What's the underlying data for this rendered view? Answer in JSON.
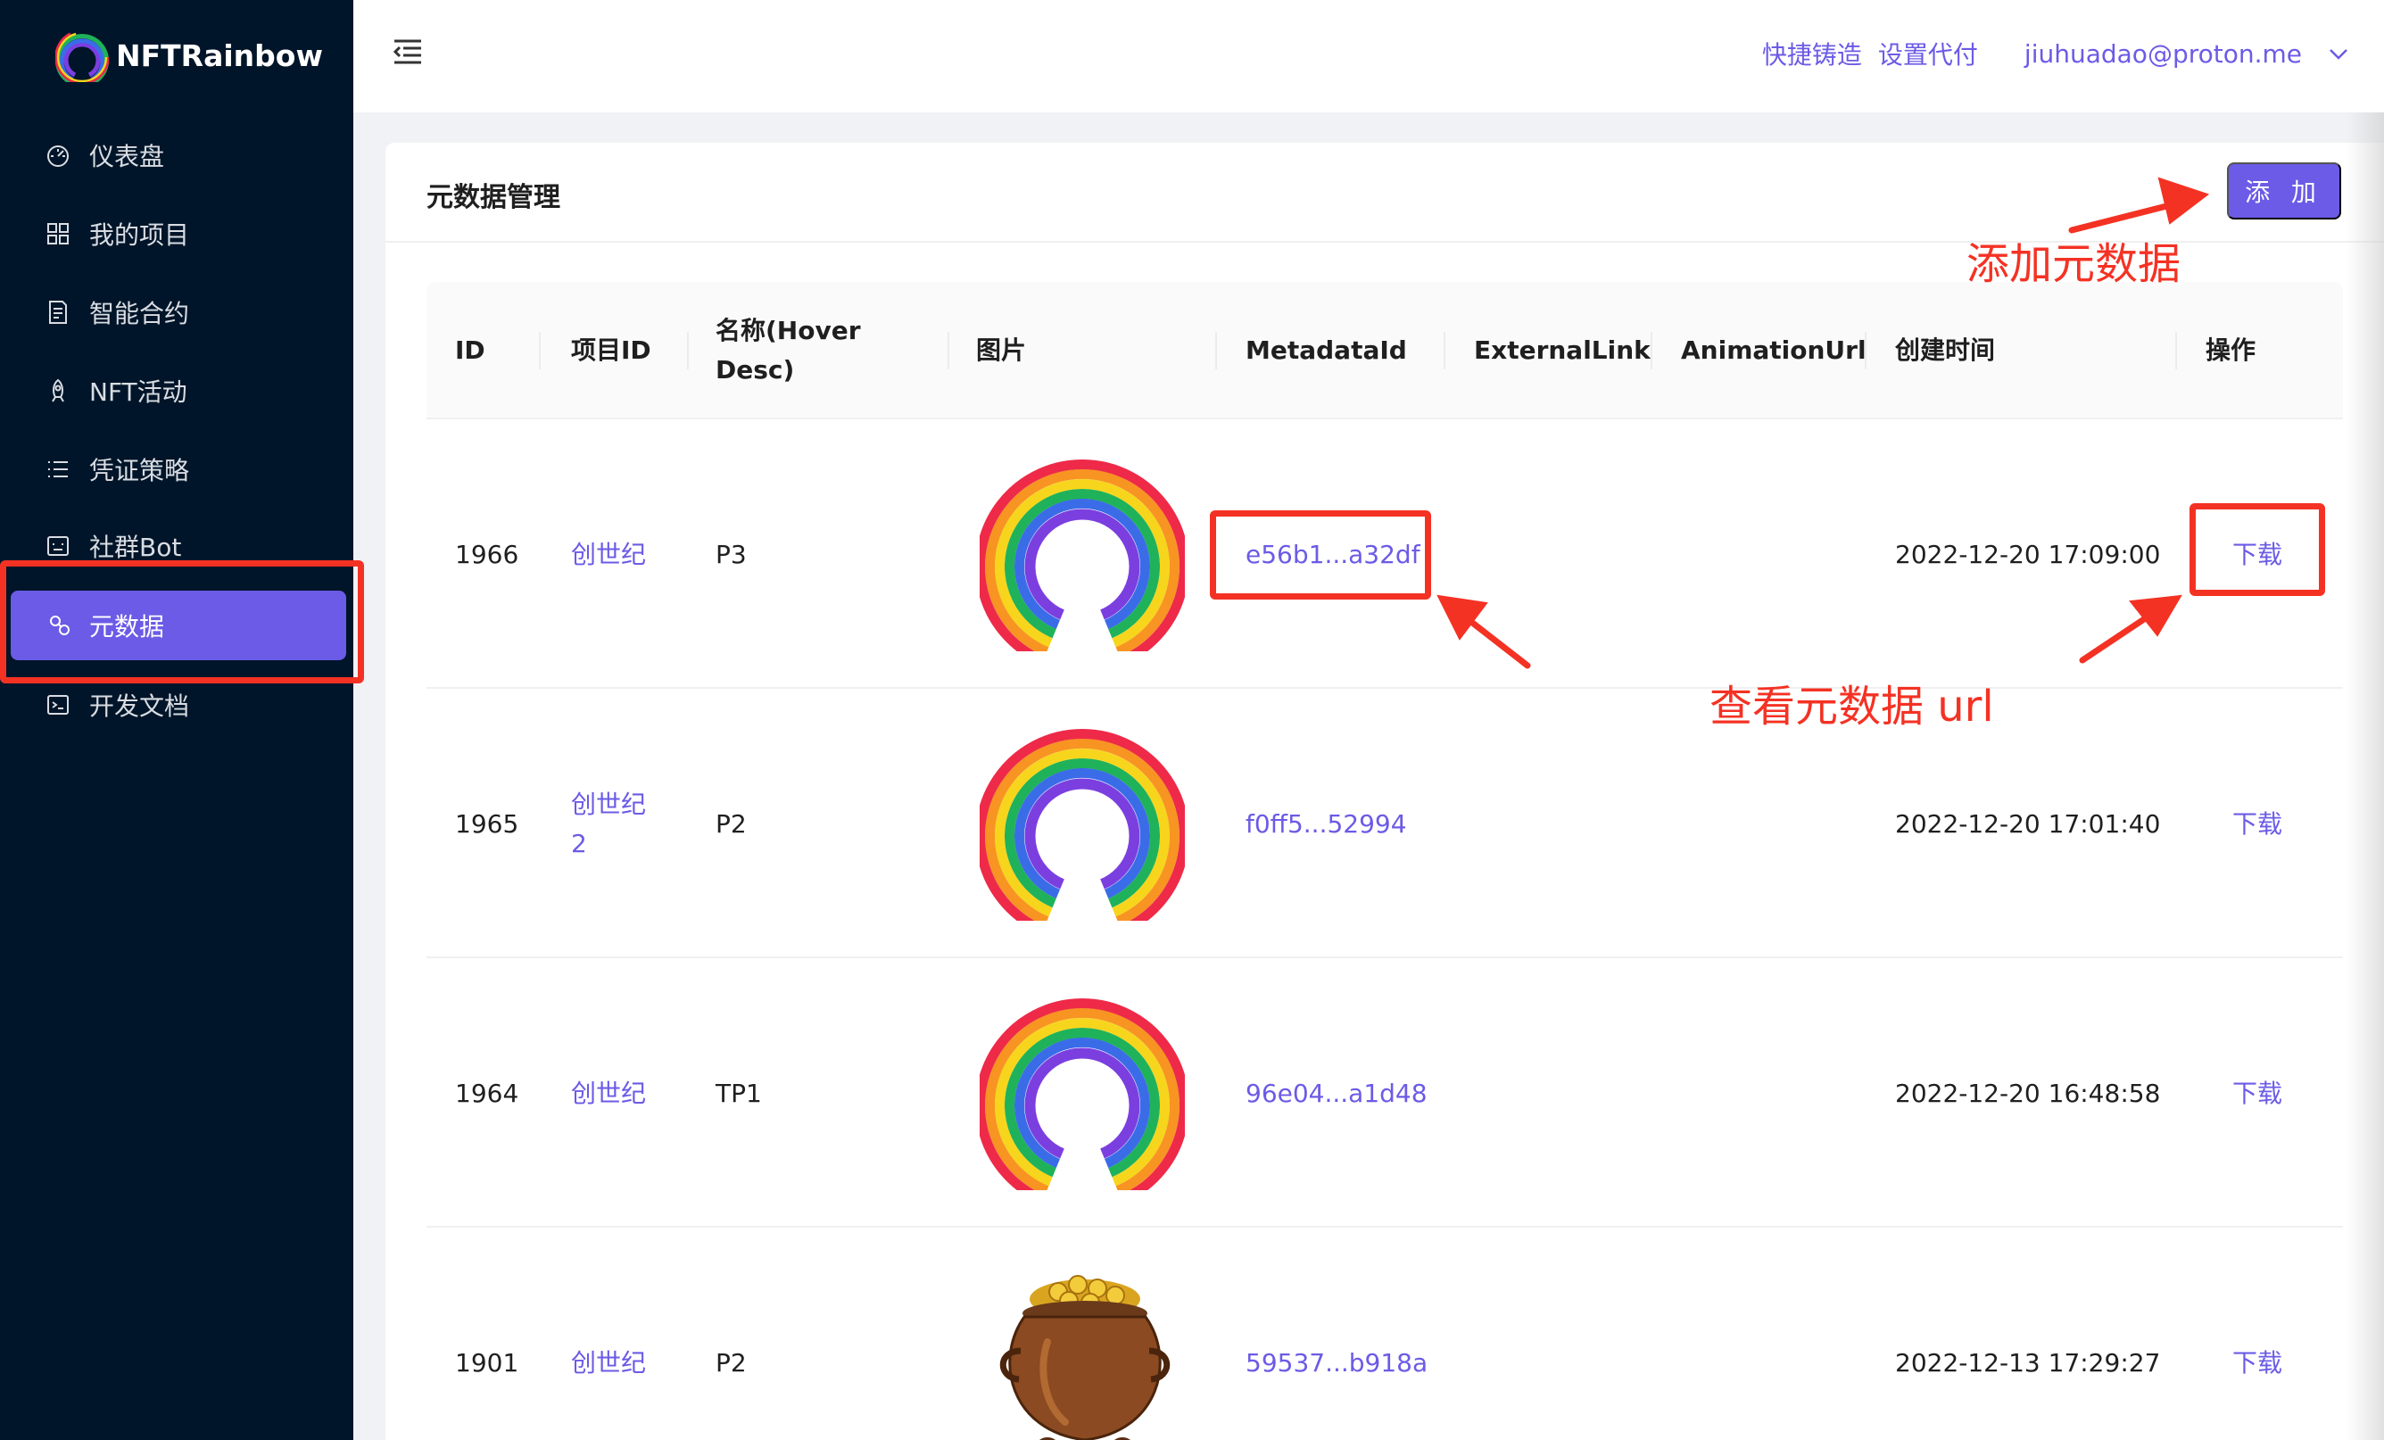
{
  "app": {
    "logo_text": "NFTRainbow"
  },
  "sidebar": {
    "items": [
      {
        "label": "仪表盘",
        "icon": "dashboard-icon"
      },
      {
        "label": "我的项目",
        "icon": "grid-icon"
      },
      {
        "label": "智能合约",
        "icon": "contract-icon"
      },
      {
        "label": "NFT活动",
        "icon": "rocket-icon"
      },
      {
        "label": "凭证策略",
        "icon": "list-icon"
      },
      {
        "label": "社群Bot",
        "icon": "bot-icon"
      },
      {
        "label": "元数据",
        "icon": "link-icon",
        "active": true
      },
      {
        "label": "开发文档",
        "icon": "terminal-icon"
      }
    ]
  },
  "header": {
    "quick_mint": "快捷铸造",
    "set_proxy": "设置代付",
    "user_email": "jiuhuadao@proton.me"
  },
  "page": {
    "title": "元数据管理",
    "add_button": "添 加"
  },
  "table": {
    "columns": [
      "ID",
      "项目ID",
      "名称(Hover Desc)",
      "图片",
      "MetadataId",
      "ExternalLink",
      "AnimationUrl",
      "创建时间",
      "操作"
    ],
    "column_name_line1": "名称(Hover",
    "column_name_line2": "Desc)",
    "rows": [
      {
        "id": "1966",
        "project": "创世纪",
        "project_line2": "",
        "name": "P3",
        "image": "rainbow",
        "metadata_id": "e56b1...a32df",
        "external_link": "",
        "animation_url": "",
        "created": "2022-12-20 17:09:00",
        "action": "下载"
      },
      {
        "id": "1965",
        "project": "创世纪",
        "project_line2": "2",
        "name": "P2",
        "image": "rainbow",
        "metadata_id": "f0ff5...52994",
        "external_link": "",
        "animation_url": "",
        "created": "2022-12-20 17:01:40",
        "action": "下载"
      },
      {
        "id": "1964",
        "project": "创世纪",
        "project_line2": "",
        "name": "TP1",
        "image": "rainbow",
        "metadata_id": "96e04...a1d48",
        "external_link": "",
        "animation_url": "",
        "created": "2022-12-20 16:48:58",
        "action": "下载"
      },
      {
        "id": "1901",
        "project": "创世纪",
        "project_line2": "",
        "name": "P2",
        "image": "pot-of-gold",
        "metadata_id": "59537...b918a",
        "external_link": "",
        "animation_url": "",
        "created": "2022-12-13 17:29:27",
        "action": "下载"
      }
    ]
  },
  "annotations": {
    "add_note": "添加元数据",
    "view_note": "查看元数据 url"
  },
  "colors": {
    "sidebar_bg": "#001529",
    "accent": "#6b5be6",
    "annotation_red": "#f43224"
  }
}
